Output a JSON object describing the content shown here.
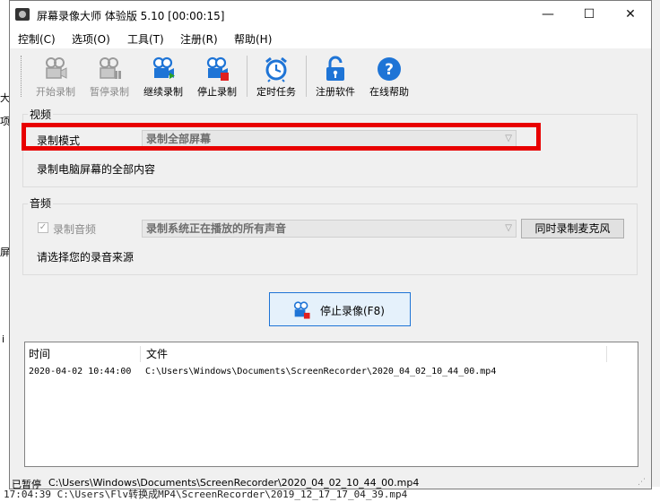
{
  "title": "屏幕录像大师 体验版 5.10 [00:00:15]",
  "window_controls": {
    "minimize": "—",
    "maximize": "☐",
    "close": "✕"
  },
  "menu": [
    "控制(C)",
    "选项(O)",
    "工具(T)",
    "注册(R)",
    "帮助(H)"
  ],
  "toolbar": [
    {
      "label": "开始录制",
      "icon": "camera-icon",
      "enabled": false
    },
    {
      "label": "暂停录制",
      "icon": "camera-pause-icon",
      "enabled": false
    },
    {
      "label": "继续录制",
      "icon": "camera-resume-icon",
      "enabled": true
    },
    {
      "label": "停止录制",
      "icon": "camera-stop-icon",
      "enabled": true
    },
    {
      "label": "定时任务",
      "icon": "alarm-clock-icon",
      "enabled": true
    },
    {
      "label": "注册软件",
      "icon": "lock-icon",
      "enabled": true
    },
    {
      "label": "在线帮助",
      "icon": "help-icon",
      "enabled": true
    }
  ],
  "video": {
    "group_title": "视频",
    "mode_label": "录制模式",
    "mode_value": "录制全部屏幕",
    "description": "录制电脑屏幕的全部内容"
  },
  "audio": {
    "group_title": "音频",
    "record_audio_label": "录制音频",
    "record_audio_checked": true,
    "source_value": "录制系统正在播放的所有声音",
    "mic_button": "同时录制麦克风",
    "description": "请选择您的录音来源"
  },
  "stop_button": "停止录像(F8)",
  "log": {
    "col_time": "时间",
    "col_file": "文件",
    "rows": [
      {
        "time": "2020-04-02 10:44:00",
        "file": "C:\\Users\\Windows\\Documents\\ScreenRecorder\\2020_04_02_10_44_00.mp4"
      }
    ]
  },
  "status": {
    "state": "已暂停",
    "path": "C:\\Users\\Windows\\Documents\\ScreenRecorder\\2020_04_02_10_44_00.mp4"
  },
  "background": {
    "bottom_text": "17:04:39   C:\\Users\\Flv转换成MP4\\ScreenRecorder\\2019_12_17_17_04_39.mp4",
    "left_chars": [
      "大",
      "项",
      "屏",
      "i"
    ]
  },
  "colors": {
    "highlight_box": "#e80000",
    "accent_blue": "#1e74d6",
    "stop_red": "#e02020"
  }
}
